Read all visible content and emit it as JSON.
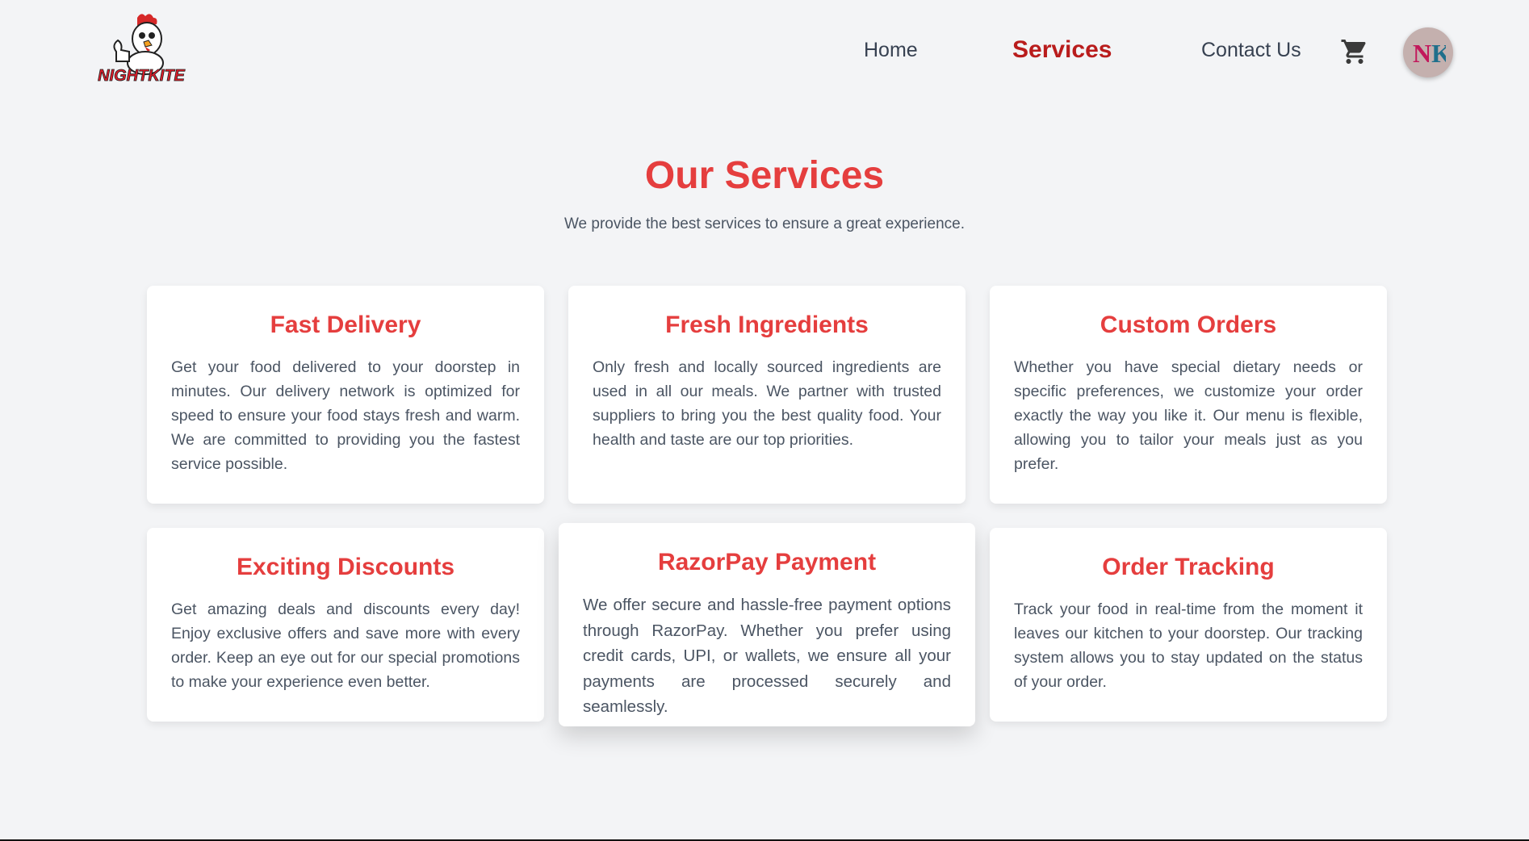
{
  "brand": {
    "name": "NIGHTKITE",
    "logo_icon": "chicken-mascot-logo"
  },
  "nav": {
    "links": [
      {
        "label": "Home"
      },
      {
        "label": "Services"
      },
      {
        "label": "Contact Us"
      }
    ],
    "active": "Services",
    "cart_icon": "cart-icon",
    "avatar_initials": "NK"
  },
  "hero": {
    "title": "Our Services",
    "subtitle": "We provide the best services to ensure a great experience."
  },
  "services": [
    {
      "title": "Fast Delivery",
      "text": "Get your food delivered to your doorstep in minutes. Our delivery network is optimized for speed to ensure your food stays fresh and warm. We are committed to providing you the fastest service possible."
    },
    {
      "title": "Fresh Ingredients",
      "text": "Only fresh and locally sourced ingredients are used in all our meals. We partner with trusted suppliers to bring you the best quality food. Your health and taste are our top priorities."
    },
    {
      "title": "Custom Orders",
      "text": "Whether you have special dietary needs or specific preferences, we customize your order exactly the way you like it. Our menu is flexible, allowing you to tailor your meals just as you prefer."
    },
    {
      "title": "Exciting Discounts",
      "text": "Get amazing deals and discounts every day! Enjoy exclusive offers and save more with every order. Keep an eye out for our special promotions to make your experience even better."
    },
    {
      "title": "RazorPay Payment",
      "text": "We offer secure and hassle-free payment options through RazorPay. Whether you prefer using credit cards, UPI, or wallets, we ensure all your payments are processed securely and seamlessly."
    },
    {
      "title": "Order Tracking",
      "text": "Track your food in real-time from the moment it leaves our kitchen to your doorstep. Our tracking system allows you to stay updated on the status of your order."
    }
  ],
  "colors": {
    "accent": "#e53e3e",
    "active_nav": "#b91c1c",
    "background": "#f3f4f6"
  }
}
